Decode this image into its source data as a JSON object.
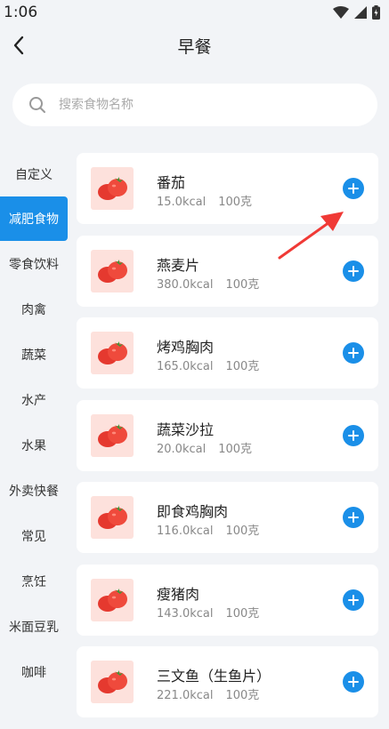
{
  "status": {
    "time": "1:06"
  },
  "header": {
    "title": "早餐"
  },
  "search": {
    "placeholder": "搜索食物名称",
    "value": ""
  },
  "categories": [
    {
      "label": "自定义",
      "active": false
    },
    {
      "label": "减肥食物",
      "active": true
    },
    {
      "label": "零食饮料",
      "active": false
    },
    {
      "label": "肉禽",
      "active": false
    },
    {
      "label": "蔬菜",
      "active": false
    },
    {
      "label": "水产",
      "active": false
    },
    {
      "label": "水果",
      "active": false
    },
    {
      "label": "外卖快餐",
      "active": false
    },
    {
      "label": "常见",
      "active": false
    },
    {
      "label": "烹饪",
      "active": false
    },
    {
      "label": "米面豆乳",
      "active": false
    },
    {
      "label": "咖啡",
      "active": false
    }
  ],
  "foods": [
    {
      "name": "番茄",
      "kcal": "15.0kcal",
      "unit": "100克"
    },
    {
      "name": "燕麦片",
      "kcal": "380.0kcal",
      "unit": "100克"
    },
    {
      "name": "烤鸡胸肉",
      "kcal": "165.0kcal",
      "unit": "100克"
    },
    {
      "name": "蔬菜沙拉",
      "kcal": "20.0kcal",
      "unit": "100克"
    },
    {
      "name": "即食鸡胸肉",
      "kcal": "116.0kcal",
      "unit": "100克"
    },
    {
      "name": "瘦猪肉",
      "kcal": "143.0kcal",
      "unit": "100克"
    },
    {
      "name": "三文鱼（生鱼片）",
      "kcal": "221.0kcal",
      "unit": "100克"
    }
  ],
  "icons": {
    "back": "chevron-left-icon",
    "search": "search-icon",
    "add": "plus-circle-icon",
    "thumb": "tomato-icon",
    "annotation": "red-arrow"
  },
  "colors": {
    "accent": "#1a8fe8",
    "thumb_bg": "#fde1dc",
    "tomato": "#e5392f",
    "arrow": "#f03a36"
  }
}
